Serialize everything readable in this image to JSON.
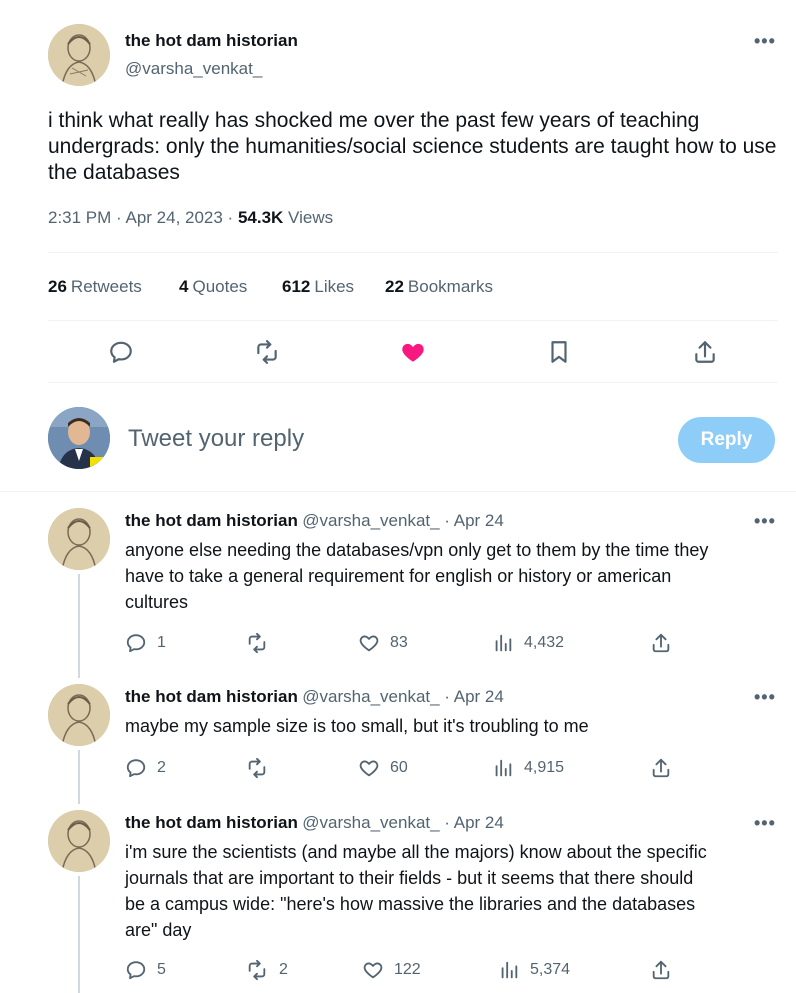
{
  "main_tweet": {
    "author_name": "the hot dam historian",
    "author_handle": "@varsha_venkat_",
    "more_label": "•••",
    "text": "i think what really has shocked me over the past few years of teaching undergrads: only the humanities/social science students are taught how to use the databases",
    "time": "2:31 PM · Apr 24, 2023 · ",
    "views_count": "54.3K",
    "views_label": " Views",
    "stats": {
      "retweets_count": "26",
      "retweets_label": "Retweets",
      "quotes_count": "4",
      "quotes_label": "Quotes",
      "likes_count": "612",
      "likes_label": "Likes",
      "bookmarks_count": "22",
      "bookmarks_label": "Bookmarks"
    },
    "liked": true,
    "like_color": "#f91880"
  },
  "reply_box": {
    "placeholder": "Tweet your reply",
    "button_label": "Reply",
    "button_color": "#8ecdf8"
  },
  "replies": [
    {
      "author_name": "the hot dam historian",
      "author_handle": "@varsha_venkat_",
      "date": " · Apr 24",
      "text_lines": [
        "anyone else needing the databases/vpn only get to them by the time they",
        "have to take a general requirement for english or history or american",
        "cultures"
      ],
      "replies_count": "1",
      "retweets_count": "",
      "likes_count": "83",
      "views_count": "4,432"
    },
    {
      "author_name": "the hot dam historian",
      "author_handle": "@varsha_venkat_",
      "date": " · Apr 24",
      "text_lines": [
        "maybe my sample size is too small, but it's troubling to me"
      ],
      "replies_count": "2",
      "retweets_count": "",
      "likes_count": "60",
      "views_count": "4,915"
    },
    {
      "author_name": "the hot dam historian",
      "author_handle": "@varsha_venkat_",
      "date": " · Apr 24",
      "text_lines": [
        "i'm sure the scientists (and maybe all the majors) know about the specific",
        "journals that are important to their fields - but it seems that there should",
        "be a campus wide: \"here's how massive the libraries and the databases",
        "are\" day"
      ],
      "replies_count": "5",
      "retweets_count": "2",
      "likes_count": "122",
      "views_count": "5,374"
    }
  ],
  "icons": {
    "reply": "reply-icon",
    "retweet": "retweet-icon",
    "like": "heart-icon",
    "bookmark": "bookmark-icon",
    "share": "share-icon",
    "views": "views-icon",
    "more": "more-icon"
  },
  "colors": {
    "text_primary": "#0f1419",
    "text_secondary": "#536471",
    "divider": "#eff3f4",
    "thread_line": "#cfd9de"
  }
}
